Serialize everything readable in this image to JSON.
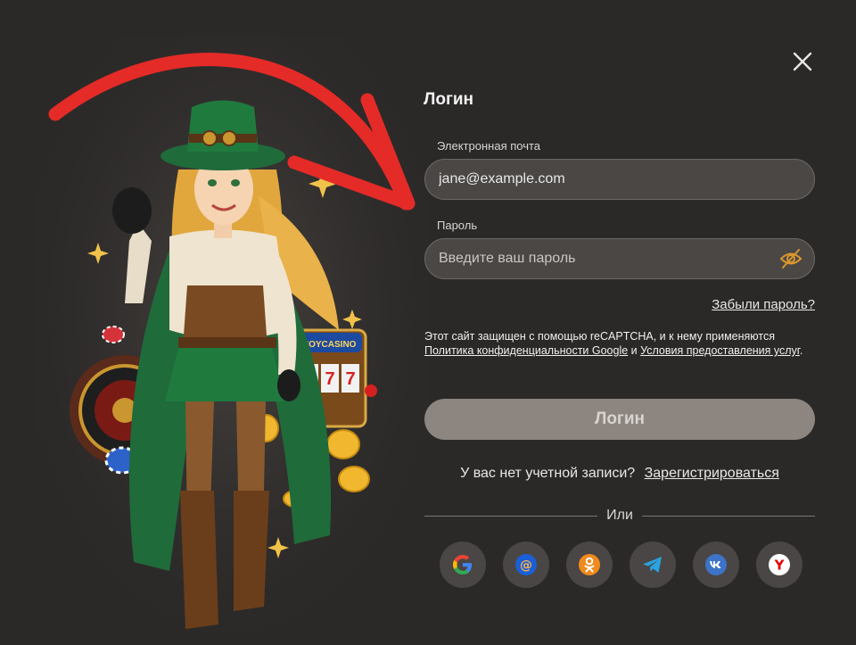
{
  "modal": {
    "title": "Логин",
    "close_icon": "close-icon"
  },
  "illustration": {
    "slot_sign": "JOYCASINO",
    "slot_reels": [
      "7",
      "7",
      "7"
    ]
  },
  "form": {
    "email_label": "Электронная почта",
    "email_value": "jane@example.com",
    "password_label": "Пароль",
    "password_placeholder": "Введите ваш пароль",
    "password_toggle_icon": "eye-off-icon",
    "forgot_link": "Забыли пароль?",
    "recaptcha_text_1": "Этот сайт защищен с помощью reCAPTCHA, и к нему применяются",
    "recaptcha_link_privacy": "Политика конфиденциальности Google",
    "recaptcha_and": "и",
    "recaptcha_link_terms": "Условия предоставления услуг",
    "recaptcha_end": ".",
    "submit_label": "Логин"
  },
  "register": {
    "prompt": "У вас нет учетной записи?",
    "link": "Зарегистрироваться"
  },
  "divider": {
    "label": "Или"
  },
  "socials": [
    {
      "name": "google",
      "icon": "google-icon",
      "color": "#4285f4"
    },
    {
      "name": "mail-ru",
      "icon": "mail-ru-icon",
      "color": "#1a5fd6"
    },
    {
      "name": "odnoklassniki",
      "icon": "odnoklassniki-icon",
      "color": "#f08a1c"
    },
    {
      "name": "telegram",
      "icon": "telegram-icon",
      "color": "#2aa3df"
    },
    {
      "name": "vk",
      "icon": "vk-icon",
      "color": "#3d73c8"
    },
    {
      "name": "yandex",
      "icon": "yandex-icon",
      "color": "#e60000"
    }
  ],
  "colors": {
    "background": "#2b2928",
    "input_bg": "#4a4745",
    "button_bg": "#8c8580",
    "arrow": "#e52b27"
  }
}
